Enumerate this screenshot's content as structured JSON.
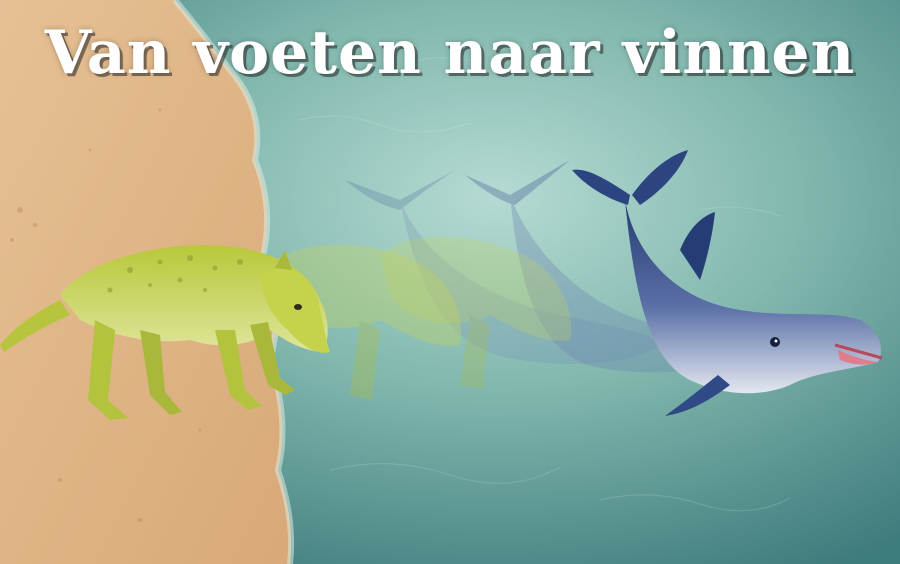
{
  "title": "Van voeten naar vinnen",
  "colors": {
    "sand": "#e2b98a",
    "water_light": "#a9d2cb",
    "water_dark": "#3f7c7d",
    "creature_green": "#c3d24a",
    "dolphin_blue": "#2f4c86",
    "dolphin_belly": "#dfe6ef"
  },
  "icons": [
    "land-mammal-illustration",
    "dolphin-illustration"
  ]
}
